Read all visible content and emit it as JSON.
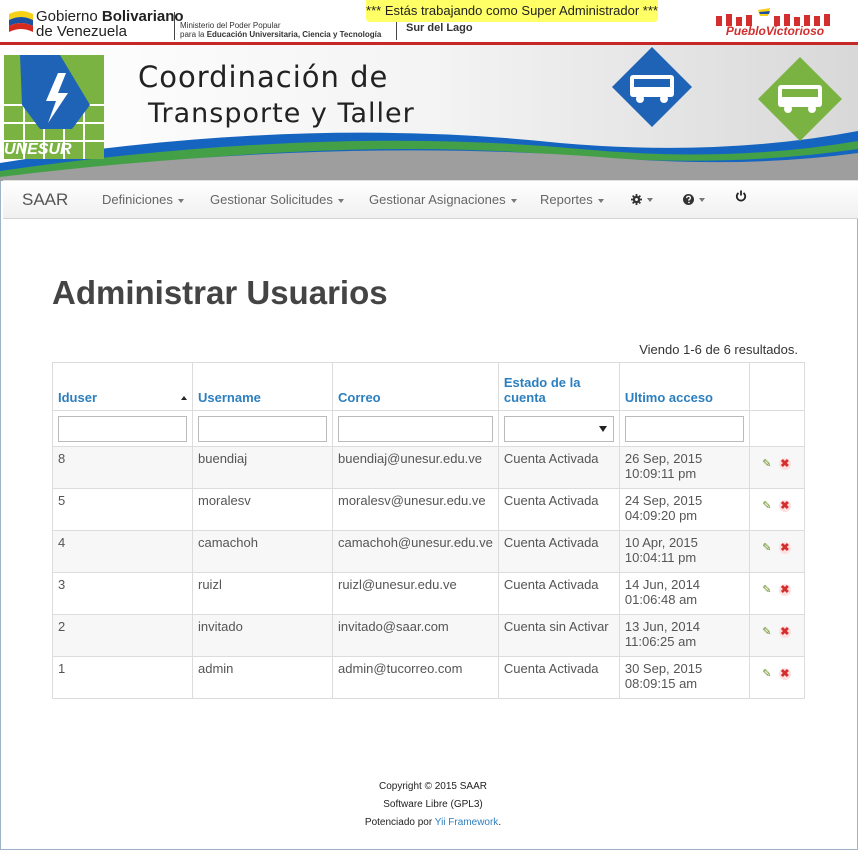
{
  "govbar": {
    "gov_name_pre": "Gobierno ",
    "gov_name_bold": "Bolivariano",
    "gov_country": "de Venezuela",
    "ministry_line1": "Ministerio del Poder Popular",
    "ministry_line2_pre": "para la ",
    "ministry_line2_bold": "Educación Universitaria, Ciencia y Tecnología",
    "region": "Sur del Lago",
    "super_admin_notice": "*** Estás trabajando como Super Administrador ***",
    "pueblo_logo": "PuebloVictorioso"
  },
  "banner": {
    "title_line1": "Coordinación de",
    "title_line2": "Transporte y Taller",
    "logo_text": "UNESUR"
  },
  "navbar": {
    "brand": "SAAR",
    "items": [
      {
        "label": "Definiciones"
      },
      {
        "label": "Gestionar Solicitudes"
      },
      {
        "label": "Gestionar Asignaciones"
      },
      {
        "label": "Reportes"
      }
    ]
  },
  "page": {
    "title": "Administrar Usuarios",
    "summary": "Viendo 1-6 de 6 resultados."
  },
  "table": {
    "columns": [
      {
        "label": "Iduser"
      },
      {
        "label_line1": "Username"
      },
      {
        "label": "Correo"
      },
      {
        "label_line1": "Estado de la",
        "label_line2": "cuenta"
      },
      {
        "label": "Ultimo acceso"
      }
    ],
    "rows": [
      {
        "iduser": "8",
        "username": "buendiaj",
        "correo": "buendiaj@unesur.edu.ve",
        "estado": "Cuenta Activada",
        "fecha": "26 Sep, 2015",
        "hora": "10:09:11 pm"
      },
      {
        "iduser": "5",
        "username": "moralesv",
        "correo": "moralesv@unesur.edu.ve",
        "estado": "Cuenta Activada",
        "fecha": "24 Sep, 2015",
        "hora": "04:09:20 pm"
      },
      {
        "iduser": "4",
        "username": "camachoh",
        "correo": "camachoh@unesur.edu.ve",
        "estado": "Cuenta Activada",
        "fecha": "10 Apr, 2015",
        "hora": "10:04:11 pm"
      },
      {
        "iduser": "3",
        "username": "ruizl",
        "correo": "ruizl@unesur.edu.ve",
        "estado": "Cuenta Activada",
        "fecha": "14 Jun, 2014",
        "hora": "01:06:48 am"
      },
      {
        "iduser": "2",
        "username": "invitado",
        "correo": "invitado@saar.com",
        "estado": "Cuenta sin Activar",
        "fecha": "13 Jun, 2014",
        "hora": "11:06:25 am"
      },
      {
        "iduser": "1",
        "username": "admin",
        "correo": "admin@tucorreo.com",
        "estado": "Cuenta Activada",
        "fecha": "30 Sep, 2015",
        "hora": "08:09:15 am"
      }
    ]
  },
  "footer": {
    "copyright": "Copyright © 2015 SAAR",
    "license": "Software Libre (GPL3)",
    "powered_pre": "Potenciado por ",
    "powered_link": "Yii Framework",
    "powered_post": "."
  },
  "colors": {
    "link": "#2c7fbf",
    "notice_bg": "#ffff66",
    "gov_red": "#c62828"
  },
  "icons": [
    "gear-icon",
    "help-icon",
    "power-icon",
    "edit-icon",
    "delete-icon",
    "sort-asc-icon"
  ]
}
